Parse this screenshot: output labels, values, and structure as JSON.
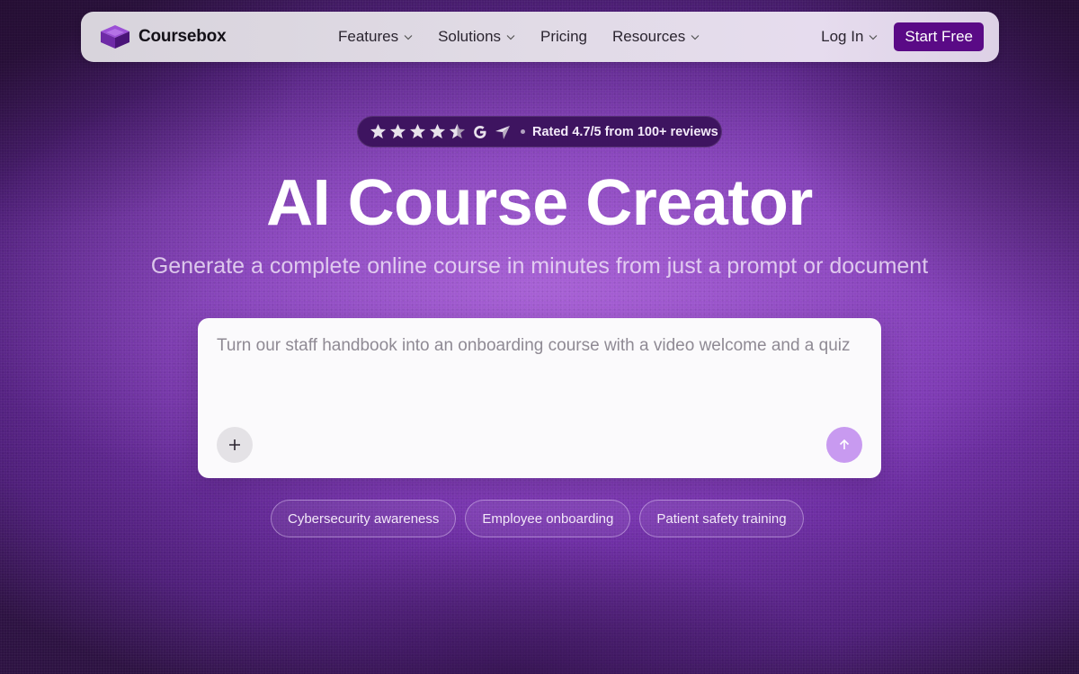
{
  "nav": {
    "logo_text": "Coursebox",
    "links": [
      {
        "label": "Features",
        "has_dropdown": true
      },
      {
        "label": "Solutions",
        "has_dropdown": true
      },
      {
        "label": "Pricing",
        "has_dropdown": false
      },
      {
        "label": "Resources",
        "has_dropdown": true
      }
    ],
    "login_label": "Log In",
    "cta_label": "Start Free"
  },
  "rating": {
    "stars": 4.5,
    "icons": [
      "star-icon",
      "google-icon",
      "capterra-icon"
    ],
    "text": "Rated 4.7/5 from 100+ reviews"
  },
  "hero": {
    "title": "AI Course Creator",
    "subtitle": "Generate a complete online course in minutes from just a prompt or document"
  },
  "prompt": {
    "placeholder": "Turn our staff handbook into an onboarding course with a video welcome and a quiz",
    "value": ""
  },
  "chips": [
    {
      "label": "Cybersecurity awareness"
    },
    {
      "label": "Employee onboarding"
    },
    {
      "label": "Patient safety training"
    }
  ],
  "colors": {
    "brand_purple": "#5a0a86",
    "send_button": "#c89af0",
    "rating_pill": "#3e1460"
  }
}
